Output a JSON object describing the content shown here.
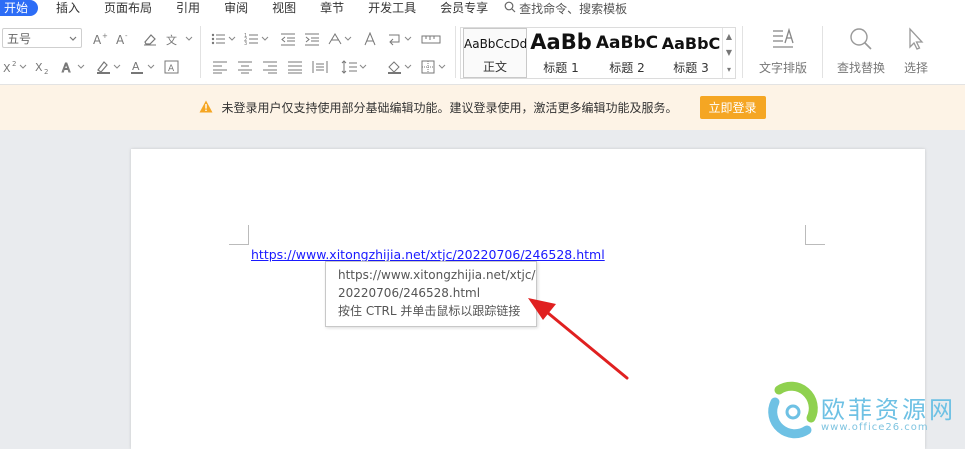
{
  "menu": {
    "items": [
      "开始",
      "插入",
      "页面布局",
      "引用",
      "审阅",
      "视图",
      "章节",
      "开发工具",
      "会员专享"
    ],
    "search_text": "查找命令、搜索模板"
  },
  "ribbon": {
    "font_size_value": "五号",
    "styles": [
      {
        "preview": "AaBbCcDd",
        "name": "正文"
      },
      {
        "preview": "AaBb",
        "name": "标题 1"
      },
      {
        "preview": "AaBbC",
        "name": "标题 2"
      },
      {
        "preview": "AaBbC",
        "name": "标题 3"
      }
    ],
    "text_layout_label": "文字排版",
    "find_replace_label": "查找替换",
    "select_label": "选择"
  },
  "notice": {
    "message": "未登录用户仅支持使用部分基础编辑功能。建议登录使用，激活更多编辑功能及服务。",
    "login_button": "立即登录"
  },
  "document": {
    "hyperlink": "https://www.xitongzhijia.net/xtjc/20220706/246528.html",
    "tooltip": {
      "line1": "https://www.xitongzhijia.net/xtjc/",
      "line2": "20220706/246528.html",
      "line3": "按住 CTRL 并单击鼠标以跟踪链接"
    }
  },
  "watermark": {
    "text": "欧菲资源网",
    "url": "www.office26.com"
  },
  "colors": {
    "accent": "#2d6df6",
    "login_button": "#f5a623",
    "notice_bg": "#fdf3e6",
    "arrow": "#e02020",
    "link": "#1a1aff"
  }
}
